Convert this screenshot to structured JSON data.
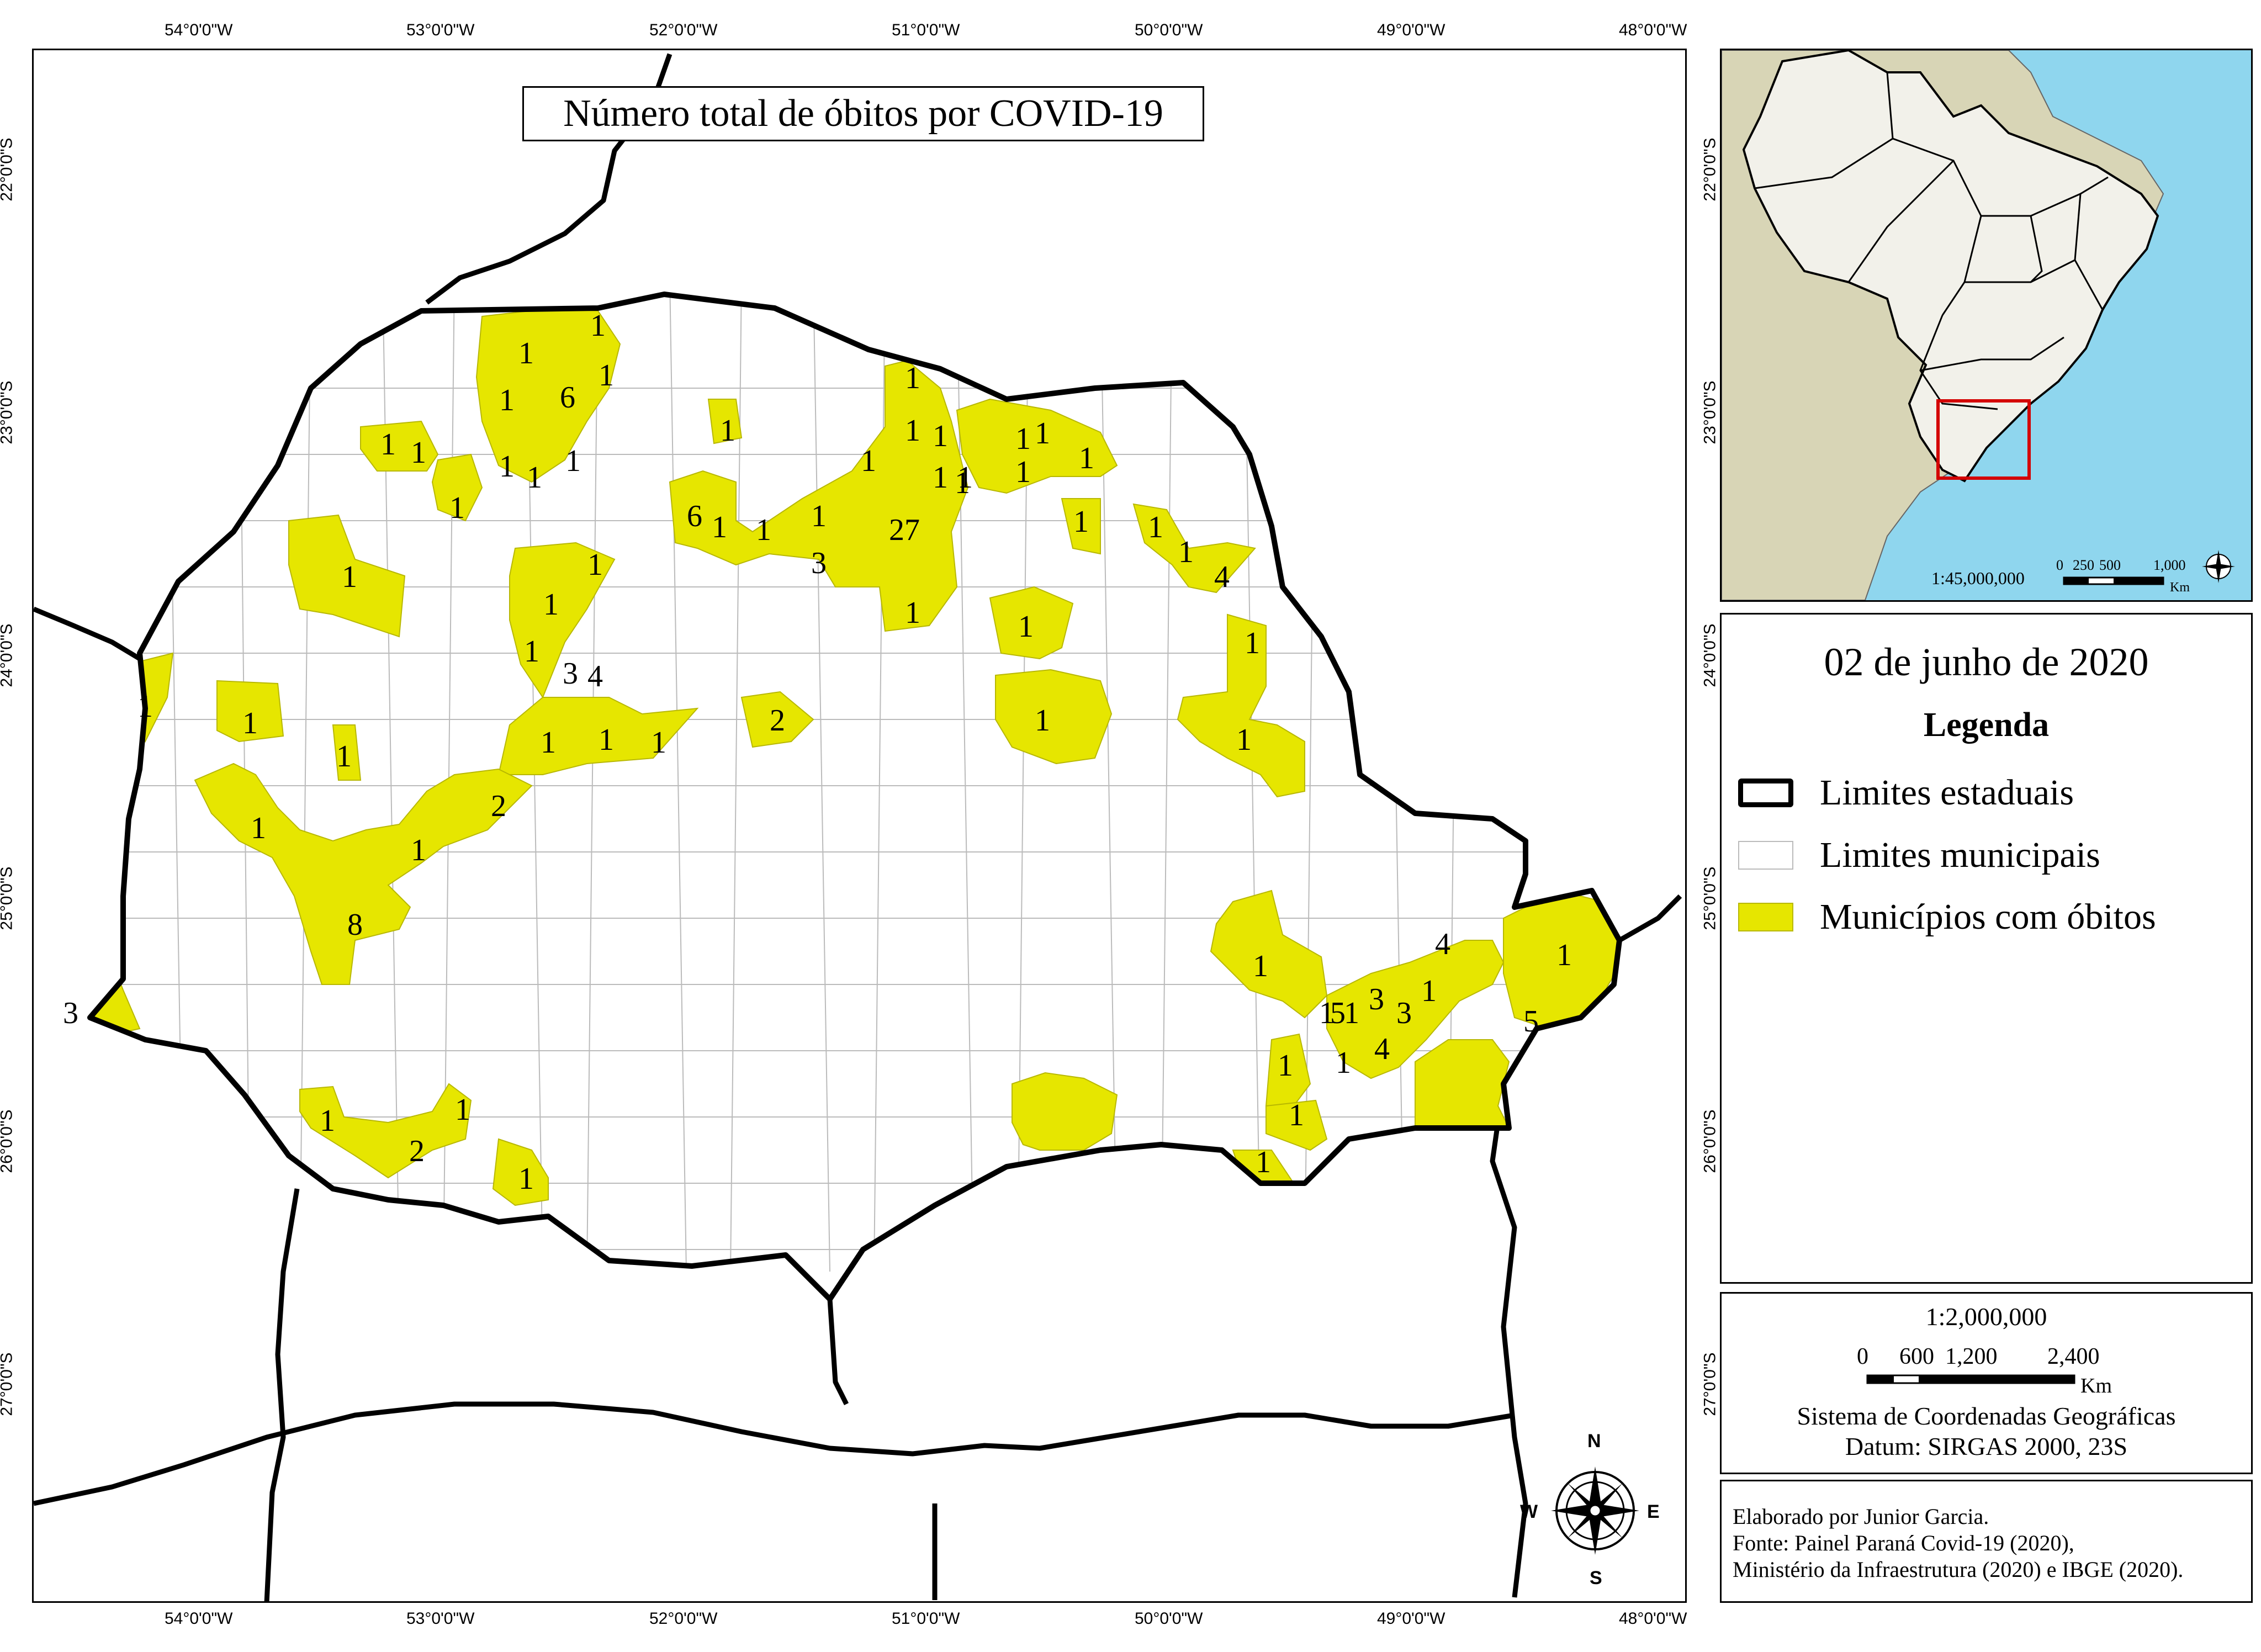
{
  "map": {
    "title": "Número total de óbitos por COVID-19",
    "lon_ticks": [
      "54°0'0\"W",
      "53°0'0\"W",
      "52°0'0\"W",
      "51°0'0\"W",
      "50°0'0\"W",
      "49°0'0\"W",
      "48°0'0\"W"
    ],
    "lat_ticks": [
      "22°0'0\"S",
      "23°0'0\"S",
      "24°0'0\"S",
      "25°0'0\"S",
      "26°0'0\"S",
      "27°0'0\"S"
    ],
    "inset_lat_ticks": [
      "22°0'0\"S",
      "23°0'0\"S",
      "24°0'0\"S",
      "25°0'0\"S",
      "26°0'0\"S",
      "27°0'0\"S"
    ],
    "colors": {
      "municipality_with_deaths": "#e6e600",
      "state_border": "#000000",
      "municipal_border": "#bbbbbb",
      "ocean": "#8fd6ee",
      "continent": "#d8d5b6",
      "brazil": "#f2f1ea",
      "highlight_box": "#d40000"
    },
    "death_counts": [
      "1",
      "1",
      "1",
      "6",
      "1",
      "1",
      "1",
      "1",
      "1",
      "1",
      "1",
      "1",
      "1",
      "1",
      "1",
      "1",
      "1",
      "1",
      "1",
      "1",
      "1",
      "1",
      "1",
      "6",
      "1",
      "1",
      "1",
      "3",
      "27",
      "1",
      "1",
      "1",
      "1",
      "1",
      "1",
      "1",
      "4",
      "3",
      "1",
      "1",
      "4",
      "2",
      "1",
      "1",
      "1",
      "1",
      "1",
      "1",
      "1",
      "1",
      "8",
      "1",
      "1",
      "2",
      "1",
      "3",
      "1",
      "1",
      "5",
      "1",
      "3",
      "3",
      "1",
      "4",
      "1",
      "4",
      "5",
      "1",
      "1",
      "1",
      "1",
      "2",
      "1",
      "1",
      "1"
    ],
    "north_arrow": {
      "n": "N",
      "s": "S",
      "e": "E",
      "w": "W",
      "icon": "compass-rose-icon"
    }
  },
  "inset": {
    "scale_text": "1:45,000,000",
    "scale_ticks": [
      "0",
      "250",
      "500",
      "1,000"
    ],
    "scale_unit": "Km",
    "icon": "compass-rose-icon"
  },
  "legend": {
    "date": "02 de junho de 2020",
    "heading": "Legenda",
    "items": [
      {
        "label": "Limites estaduais",
        "icon": "thick-border-swatch"
      },
      {
        "label": "Limites municipais",
        "icon": "thin-border-swatch"
      },
      {
        "label": "Municípios com óbitos",
        "icon": "yellow-fill-swatch"
      }
    ]
  },
  "scale": {
    "ratio": "1:2,000,000",
    "ticks": [
      "0",
      "600",
      "1,200",
      "2,400"
    ],
    "unit": "Km",
    "crs_line1": "Sistema de Coordenadas Geográficas",
    "crs_line2": "Datum: SIRGAS 2000, 23S"
  },
  "credits": {
    "line1": "Elaborado por Junior Garcia.",
    "line2": "Fonte: Painel Paraná Covid-19 (2020),",
    "line3": "Ministério da Infraestrutura (2020) e IBGE (2020)."
  }
}
